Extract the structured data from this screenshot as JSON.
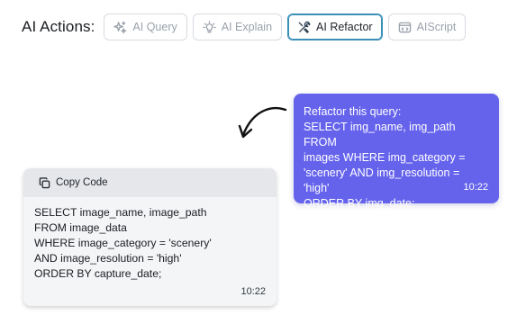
{
  "toolbar": {
    "label": "AI Actions:",
    "buttons": [
      {
        "label": "AI Query",
        "icon": "sparkles-icon",
        "active": false
      },
      {
        "label": "AI Explain",
        "icon": "lightbulb-icon",
        "active": false
      },
      {
        "label": "AI Refactor",
        "icon": "tools-icon",
        "active": true
      },
      {
        "label": "AIScript",
        "icon": "script-window-icon",
        "active": false
      }
    ]
  },
  "user_message": {
    "lines": [
      "Refactor this query:",
      "SELECT img_name, img_path FROM",
      "images WHERE img_category =",
      "'scenery' AND img_resolution = 'high'",
      "ORDER BY img_date;"
    ],
    "time": "10:22"
  },
  "response": {
    "copy_label": "Copy Code",
    "code_lines": [
      "SELECT image_name, image_path",
      "FROM image_data",
      "WHERE image_category = 'scenery'",
      "AND image_resolution = 'high'",
      "ORDER BY capture_date;"
    ],
    "time": "10:22"
  },
  "colors": {
    "user_bubble": "#6563ec",
    "active_border": "#3a8fb7"
  }
}
